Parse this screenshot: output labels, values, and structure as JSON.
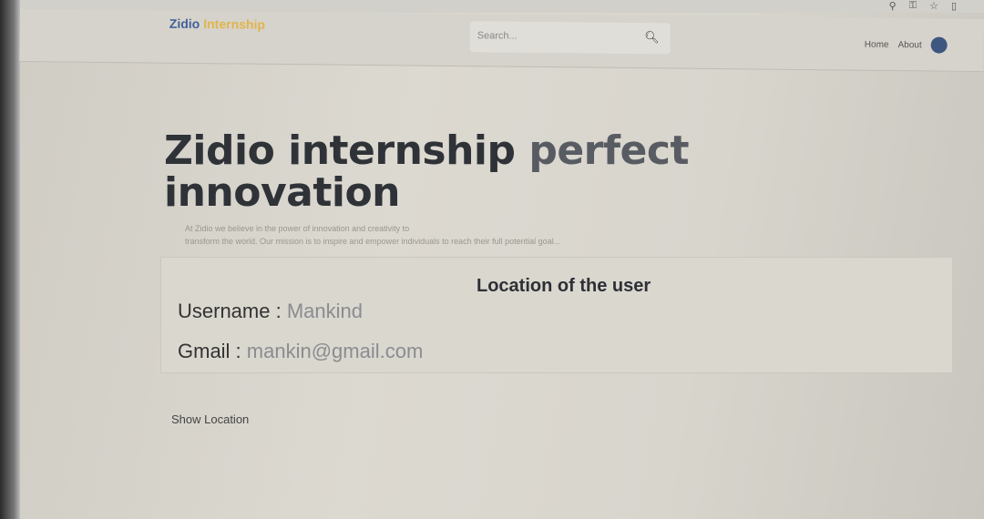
{
  "browser": {
    "icons": [
      "location-icon",
      "key-icon",
      "star-icon",
      "extension-icon"
    ]
  },
  "nav": {
    "logo_first": "Zidio",
    "logo_second": "Internship",
    "search_placeholder": "Search...",
    "links": [
      "Home",
      "About"
    ]
  },
  "hero": {
    "title_dark": "Zidio internship",
    "title_gray": "perfect",
    "title_line2": "innovation",
    "description_line1": "At Zidio we believe in the power of innovation and creativity to",
    "description_line2": "transform the world. Our mission is to inspire and empower individuals to reach their full potential goal..."
  },
  "card": {
    "heading": "Location of the user",
    "username_label": "Username : ",
    "username_value": "Mankind",
    "gmail_label": "Gmail : ",
    "gmail_value": "mankin@gmail.com"
  },
  "show_location_label": "Show Location",
  "colors": {
    "logo_primary": "#41609a",
    "logo_accent": "#e0b54a"
  }
}
